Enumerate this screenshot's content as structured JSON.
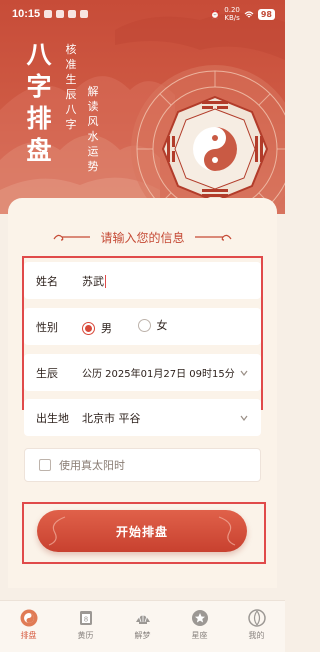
{
  "status_bar": {
    "time": "10:15",
    "net_speed_value": "0.20",
    "net_speed_unit": "KB/s",
    "battery": "98"
  },
  "hero": {
    "title": [
      "八",
      "字",
      "排",
      "盘"
    ],
    "slogan_1": "核准生辰八字",
    "slogan_2": "解读风水运势"
  },
  "form": {
    "heading": "请输入您的信息",
    "name_label": "姓名",
    "name_value": "苏武",
    "gender_label": "性别",
    "gender_male": "男",
    "gender_female": "女",
    "gender_selected": "男",
    "birth_label": "生辰",
    "birth_value": "公历 2025年01月27日 09时15分",
    "place_label": "出生地",
    "place_value": "北京市 平谷",
    "solar_time_label": "使用真太阳时",
    "solar_time_checked": false,
    "submit_label": "开始排盘"
  },
  "bottom_nav": [
    {
      "label": "排盘",
      "icon": "bagua-app-icon",
      "active": true
    },
    {
      "label": "黄历",
      "icon": "calendar-icon",
      "active": false
    },
    {
      "label": "解梦",
      "icon": "shell-icon",
      "active": false
    },
    {
      "label": "星座",
      "icon": "star-badge-icon",
      "active": false
    },
    {
      "label": "我的",
      "icon": "profile-icon",
      "active": false
    }
  ],
  "colors": {
    "accent": "#d8493a",
    "hero": "#c74c38",
    "highlight_border": "#e04a4a",
    "background": "#f7efe6"
  }
}
